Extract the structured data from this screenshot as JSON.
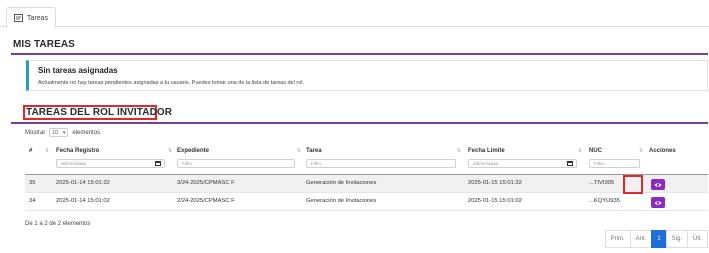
{
  "tab": {
    "label": "Tareas",
    "icon": "tasks-icon"
  },
  "mis_tareas": {
    "title": "MIS TAREAS",
    "alert_title": "Sin tareas asignadas",
    "alert_text": "Actualmente no hay tareas pendientes asignadas a tu usuario. Puedes tomar una de la lista de tareas del rol."
  },
  "rol": {
    "title": "TAREAS DEL ROL INVITADOR",
    "show_label": "Mostrar",
    "length_value": "10",
    "elements_label": "elementos"
  },
  "table": {
    "headers": {
      "num": "#",
      "fecha_registro": "Fecha Registro",
      "expediente": "Expediente",
      "tarea": "Tarea",
      "fecha_limite": "Fecha Limite",
      "nuc": "NUC",
      "acciones": "Acciones"
    },
    "filters": {
      "fecha_registro": "dd/mm/aaaa",
      "expediente": "Filtro",
      "tarea": "Filtro",
      "fecha_limite": "dd/mm/aaaa",
      "nuc": "Filtro"
    },
    "rows": [
      {
        "num": "35",
        "fecha_registro": "2025-01-14 15:01:32",
        "expediente": "3/24-2025/CPMASC F",
        "tarea": "Generación de Invitaciones",
        "fecha_limite": "2025-01-15 15:01:32",
        "nuc": "...TIVI305"
      },
      {
        "num": "34",
        "fecha_registro": "2025-01-14 15:01:02",
        "expediente": "2/24-2025/CPMASC F",
        "tarea": "Generación de Invitaciones",
        "fecha_limite": "2025-01-15 15:01:02",
        "nuc": "...KQYU935"
      }
    ]
  },
  "info": "De 1 a 2 de 2 elementos",
  "pager": {
    "first": "Prim.",
    "prev": "Ant.",
    "current": "1",
    "next": "Sig.",
    "last": "Últ."
  },
  "colors": {
    "accent": "#7a3f98",
    "alert_border": "#2a9fb2",
    "action_button": "#8a2ac1",
    "highlight": "#e22828",
    "page_active": "#1e6fd9"
  }
}
